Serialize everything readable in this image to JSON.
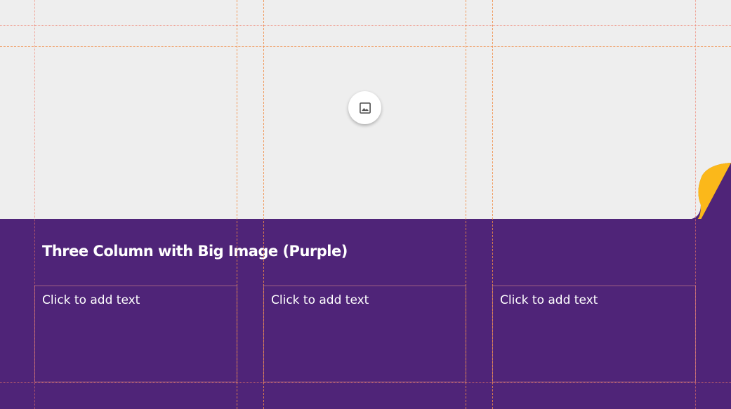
{
  "slide": {
    "title": "Three Column with Big Image (Purple)",
    "columns": [
      {
        "placeholder": "Click to add text"
      },
      {
        "placeholder": "Click to add text"
      },
      {
        "placeholder": "Click to add text"
      }
    ]
  },
  "image_placeholder": {
    "icon": "image-icon"
  },
  "colors": {
    "band": "#4f2478",
    "image_bg": "#eeeeee",
    "accent": "#fbb81a",
    "guide": "#f08c46",
    "text": "#ffffff"
  }
}
